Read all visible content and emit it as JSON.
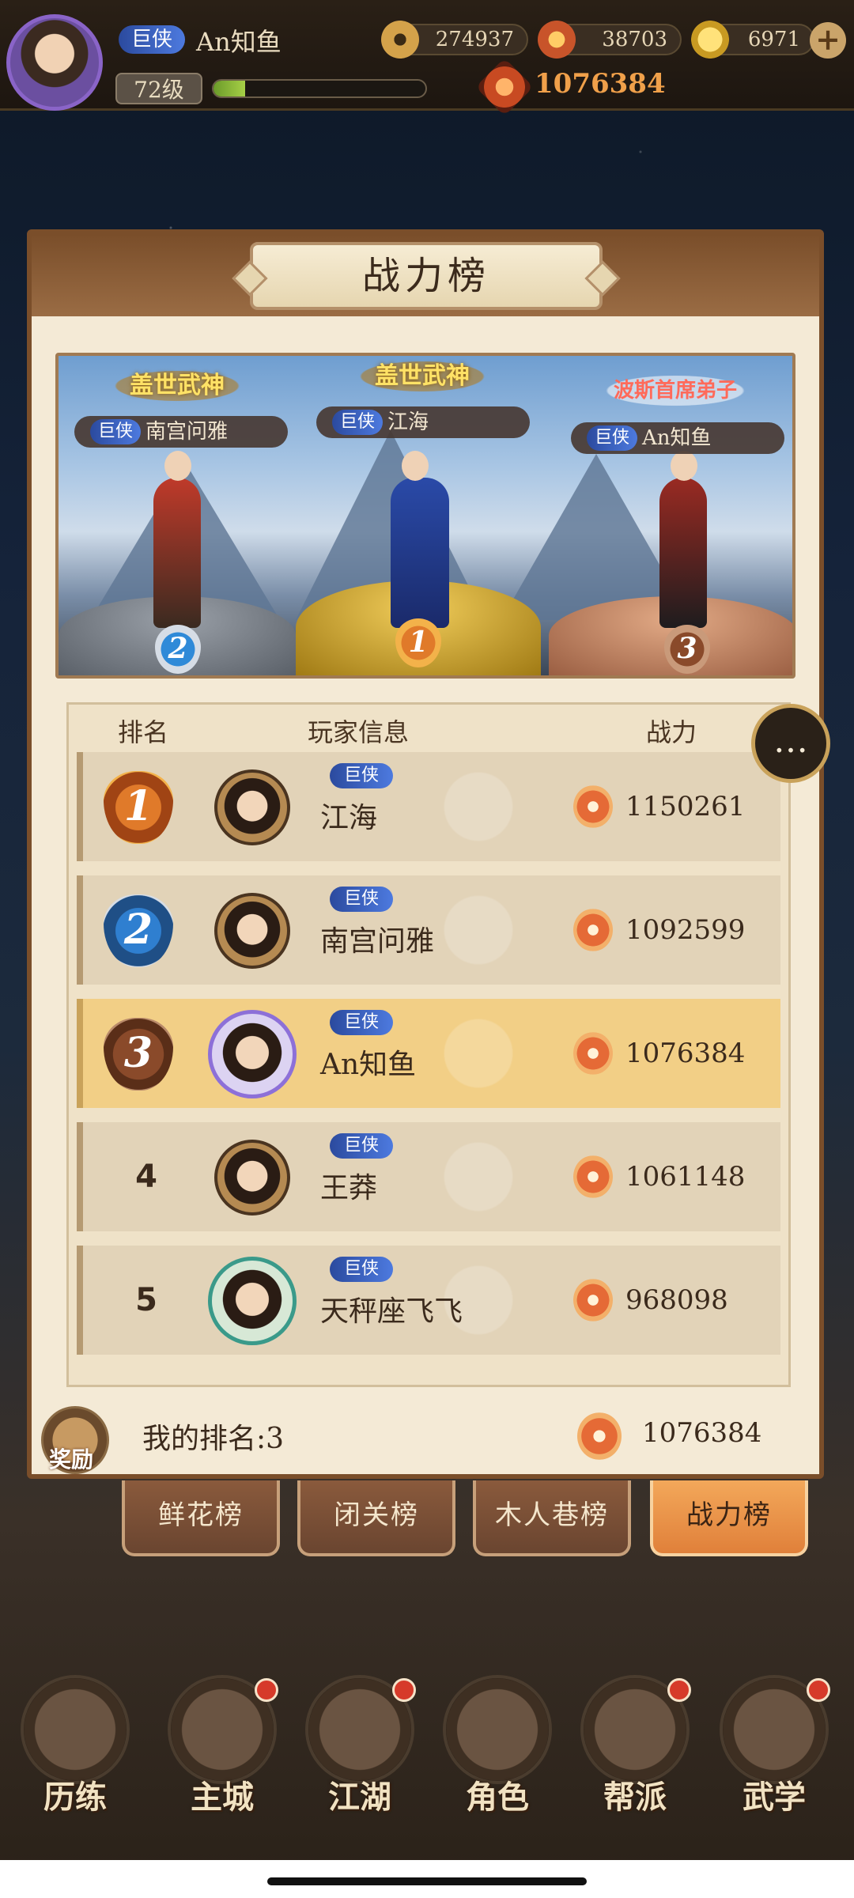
{
  "player": {
    "title_badge": "巨侠",
    "name": "An知鱼",
    "level": "72级",
    "exp_fraction": 0.15
  },
  "resources": [
    {
      "icon": "coin-icon",
      "value": "274937"
    },
    {
      "icon": "ingot-icon",
      "value": "38703"
    },
    {
      "icon": "gold-icon",
      "value": "6971"
    }
  ],
  "power_top": "1076384",
  "panel": {
    "title": "战力榜"
  },
  "podium": {
    "slots": [
      {
        "rank": "2",
        "title": "盖世武神",
        "badge": "巨侠",
        "name": "南宫问雅"
      },
      {
        "rank": "1",
        "title": "盖世武神",
        "badge": "巨侠",
        "name": "江海"
      },
      {
        "rank": "3",
        "title": "波斯首席弟子",
        "badge": "巨侠",
        "name": "An知鱼"
      }
    ]
  },
  "table": {
    "headers": {
      "rank": "排名",
      "info": "玩家信息",
      "power": "战力"
    },
    "rows": [
      {
        "rank": "1",
        "badge": "巨侠",
        "name": "江海",
        "power": "1150261"
      },
      {
        "rank": "2",
        "badge": "巨侠",
        "name": "南宫问雅",
        "power": "1092599"
      },
      {
        "rank": "3",
        "badge": "巨侠",
        "name": "An知鱼",
        "power": "1076384"
      },
      {
        "rank": "4",
        "badge": "巨侠",
        "name": "王莽",
        "power": "1061148"
      },
      {
        "rank": "5",
        "badge": "巨侠",
        "name": "天秤座飞飞",
        "power": "968098"
      }
    ]
  },
  "footer": {
    "reward_label": "奖励",
    "my_rank": "我的排名:3",
    "my_power": "1076384"
  },
  "tabs": [
    {
      "label": "鲜花榜",
      "active": false
    },
    {
      "label": "闭关榜",
      "active": false
    },
    {
      "label": "木人巷榜",
      "active": false
    },
    {
      "label": "战力榜",
      "active": true
    }
  ],
  "nav": [
    {
      "label": "历练",
      "dot": false
    },
    {
      "label": "主城",
      "dot": true
    },
    {
      "label": "江湖",
      "dot": true
    },
    {
      "label": "角色",
      "dot": false
    },
    {
      "label": "帮派",
      "dot": true
    },
    {
      "label": "武学",
      "dot": true
    }
  ],
  "colors": {
    "accent": "#f3a85a",
    "panel": "#f4ead6",
    "frame": "#7a4e2a",
    "highlight_row": "#f2cf86",
    "badge_blue": "#2b4a9e"
  }
}
